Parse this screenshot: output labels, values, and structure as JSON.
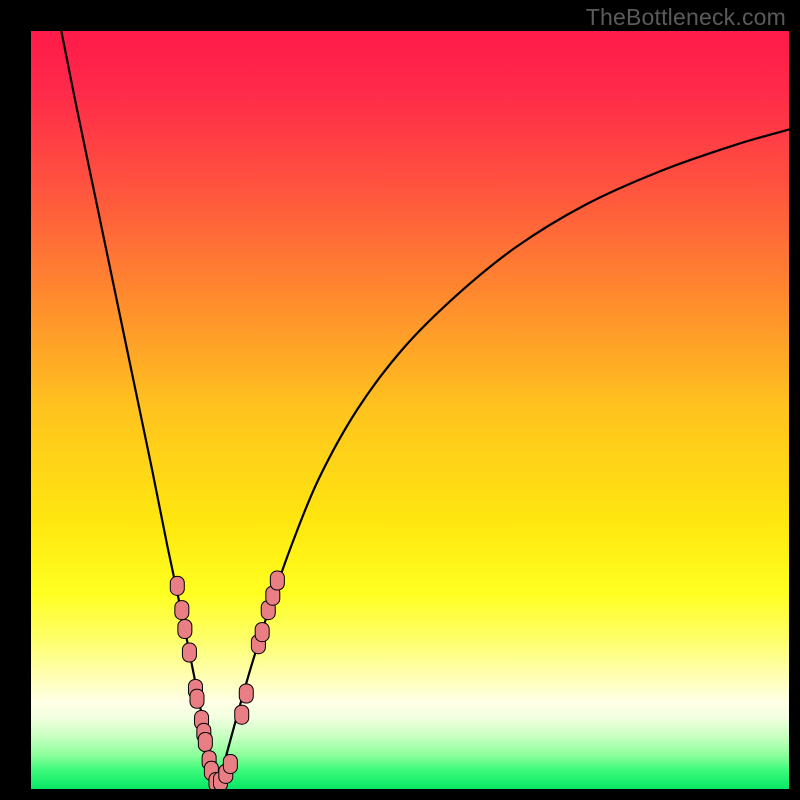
{
  "watermark": {
    "text": "TheBottleneck.com"
  },
  "colors": {
    "bg_black": "#000000",
    "curve": "#000000",
    "marker_fill": "#e97e84",
    "marker_stroke": "#000000",
    "gradient_stops": [
      {
        "o": 0.0,
        "c": "#ff1a4a"
      },
      {
        "o": 0.08,
        "c": "#ff2a4a"
      },
      {
        "o": 0.2,
        "c": "#ff513f"
      },
      {
        "o": 0.35,
        "c": "#ff8a2e"
      },
      {
        "o": 0.5,
        "c": "#ffc41e"
      },
      {
        "o": 0.65,
        "c": "#ffe70f"
      },
      {
        "o": 0.74,
        "c": "#ffff20"
      },
      {
        "o": 0.8,
        "c": "#feff66"
      },
      {
        "o": 0.855,
        "c": "#ffffb8"
      },
      {
        "o": 0.885,
        "c": "#ffffe6"
      },
      {
        "o": 0.905,
        "c": "#f2ffe0"
      },
      {
        "o": 0.93,
        "c": "#c9ffc2"
      },
      {
        "o": 0.955,
        "c": "#8dff9b"
      },
      {
        "o": 0.975,
        "c": "#3dfb7a"
      },
      {
        "o": 1.0,
        "c": "#07e765"
      }
    ]
  },
  "chart_data": {
    "type": "line",
    "title": "",
    "xlabel": "",
    "ylabel": "",
    "xlim": [
      0,
      100
    ],
    "ylim": [
      0,
      100
    ],
    "grid": false,
    "legend": false,
    "notes": "Bottleneck-style V-curve. x ≈ component balance position (arbitrary 0–100). y ≈ bottleneck percentage (0 at minimum, ~100 at top). Minimum near x≈24. Values estimated from pixel positions.",
    "series": [
      {
        "name": "left-branch",
        "x": [
          4.0,
          6.0,
          8.5,
          11.0,
          13.5,
          16.0,
          18.0,
          19.7,
          21.0,
          22.2,
          23.0,
          23.8,
          24.3
        ],
        "y": [
          100.0,
          90.0,
          78.0,
          66.0,
          54.0,
          42.0,
          32.0,
          24.0,
          17.5,
          11.5,
          7.0,
          3.0,
          0.5
        ]
      },
      {
        "name": "right-branch",
        "x": [
          24.6,
          25.5,
          27.0,
          29.0,
          31.5,
          34.5,
          38.0,
          43.0,
          49.0,
          56.0,
          64.0,
          73.0,
          83.0,
          93.0,
          100.0
        ],
        "y": [
          0.5,
          3.5,
          9.0,
          16.0,
          24.0,
          32.5,
          41.0,
          50.0,
          58.0,
          65.0,
          71.5,
          77.0,
          81.5,
          85.0,
          87.0
        ]
      }
    ],
    "markers": {
      "name": "highlighted-points",
      "note": "Pink rounded markers clustered near the trough on both branches.",
      "points": [
        {
          "x": 19.3,
          "y": 26.8
        },
        {
          "x": 19.9,
          "y": 23.6
        },
        {
          "x": 20.3,
          "y": 21.1
        },
        {
          "x": 20.9,
          "y": 18.0
        },
        {
          "x": 21.7,
          "y": 13.2
        },
        {
          "x": 21.9,
          "y": 11.9
        },
        {
          "x": 22.5,
          "y": 9.1
        },
        {
          "x": 22.8,
          "y": 7.4
        },
        {
          "x": 23.0,
          "y": 6.2
        },
        {
          "x": 23.5,
          "y": 3.8
        },
        {
          "x": 23.8,
          "y": 2.4
        },
        {
          "x": 24.4,
          "y": 0.9
        },
        {
          "x": 25.0,
          "y": 1.0
        },
        {
          "x": 25.7,
          "y": 2.0
        },
        {
          "x": 26.3,
          "y": 3.3
        },
        {
          "x": 27.8,
          "y": 9.8
        },
        {
          "x": 28.4,
          "y": 12.6
        },
        {
          "x": 30.0,
          "y": 19.1
        },
        {
          "x": 30.5,
          "y": 20.7
        },
        {
          "x": 31.3,
          "y": 23.6
        },
        {
          "x": 31.9,
          "y": 25.5
        },
        {
          "x": 32.5,
          "y": 27.5
        }
      ]
    }
  }
}
